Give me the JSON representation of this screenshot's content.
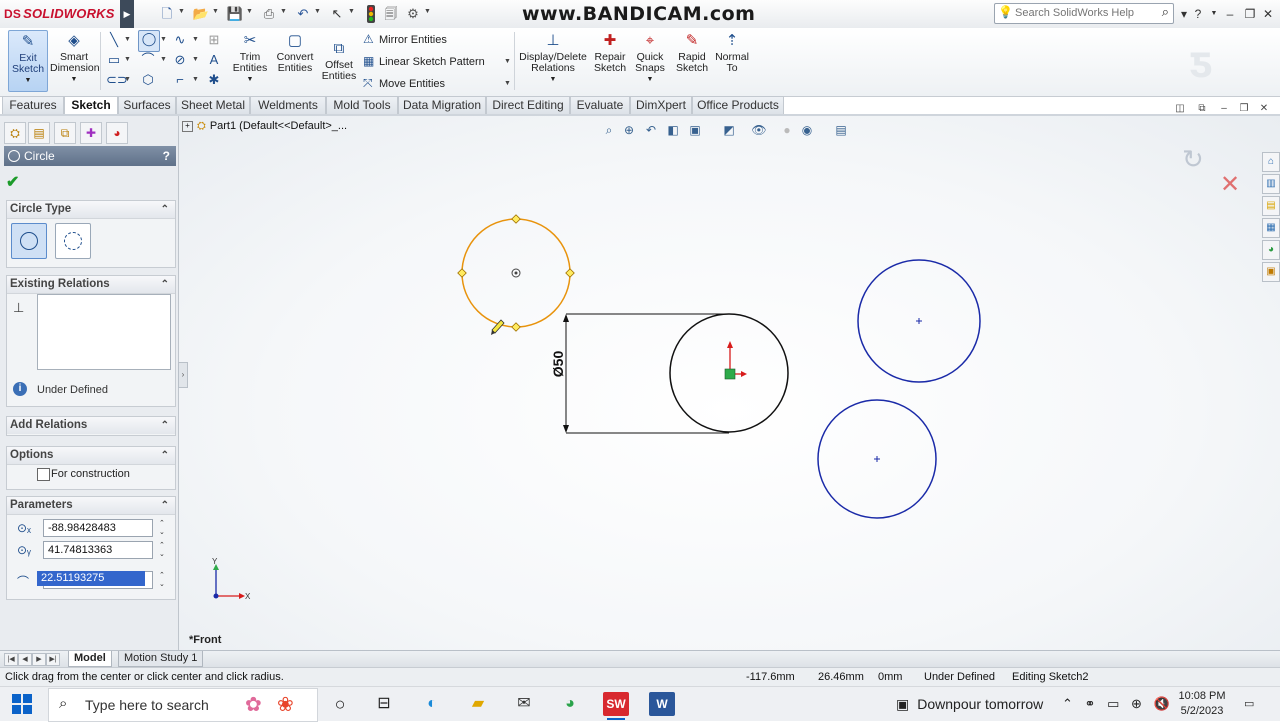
{
  "app": {
    "brand": "SOLIDWORKS",
    "brand_mark": "DS",
    "watermark": "www.BANDICAM.com",
    "help_search_placeholder": "Search SolidWorks Help"
  },
  "icons": {
    "new": "new-document-icon",
    "open": "open-folder-icon",
    "save": "save-icon",
    "print": "print-icon",
    "undo": "undo-icon",
    "select": "select-arrow-icon",
    "rebuild": "rebuild-traffic-light-icon",
    "file_props": "file-properties-icon",
    "options": "options-icon"
  },
  "ribbon": {
    "exit_sketch": "Exit\nSketch",
    "smart_dimension": "Smart\nDimension",
    "trim_entities": "Trim\nEntities",
    "convert_entities": "Convert\nEntities",
    "offset_entities": "Offset\nEntities",
    "mirror_entities": "Mirror Entities",
    "linear_sketch_pattern": "Linear Sketch Pattern",
    "move_entities": "Move Entities",
    "display_delete_relations": "Display/Delete\nRelations",
    "repair_sketch": "Repair\nSketch",
    "quick_snaps": "Quick\nSnaps",
    "rapid_sketch": "Rapid\nSketch",
    "normal_to": "Normal\nTo"
  },
  "tabs": [
    {
      "label": "Features"
    },
    {
      "label": "Sketch"
    },
    {
      "label": "Surfaces"
    },
    {
      "label": "Sheet Metal"
    },
    {
      "label": "Weldments"
    },
    {
      "label": "Mold Tools"
    },
    {
      "label": "Data Migration"
    },
    {
      "label": "Direct Editing"
    },
    {
      "label": "Evaluate"
    },
    {
      "label": "DimXpert"
    },
    {
      "label": "Office Products"
    }
  ],
  "active_tab": "Sketch",
  "property_manager": {
    "title": "Circle",
    "help": "?",
    "circle_type_header": "Circle Type",
    "existing_relations_header": "Existing Relations",
    "status_text": "Under Defined",
    "add_relations_header": "Add Relations",
    "options_header": "Options",
    "for_construction": "For construction",
    "for_construction_checked": false,
    "parameters_header": "Parameters",
    "center_x": "-88.98428483",
    "center_y": "41.74813363",
    "radius": "22.51193275"
  },
  "tree": {
    "part_label": "Part1  (Default<<Default>_..."
  },
  "viewport": {
    "orientation": "*Front",
    "dimension_text": "Ø50",
    "axis_x": "X",
    "axis_y": "Y",
    "colors": {
      "highlight": "#e8930c",
      "sketch_blue": "#1a2aa8",
      "defined_black": "#111111"
    }
  },
  "model_tabs": [
    {
      "label": "Model"
    },
    {
      "label": "Motion Study 1"
    }
  ],
  "status": {
    "hint": "Click drag from the center or click center and click radius.",
    "x": "-117.6mm",
    "y": "26.46mm",
    "z": "0mm",
    "state": "Under Defined",
    "editing": "Editing Sketch2"
  },
  "taskbar": {
    "search_placeholder": "Type here to search",
    "weather": "Downpour tomorrow",
    "time": "10:08 PM",
    "date": "5/2/2023"
  }
}
